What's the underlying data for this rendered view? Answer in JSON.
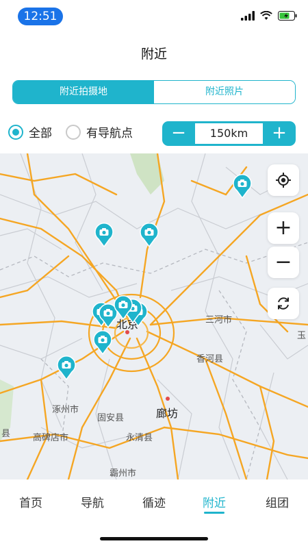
{
  "status_bar": {
    "time": "12:51"
  },
  "header": {
    "title": "附近"
  },
  "segment": {
    "tabs": [
      {
        "label": "附近拍摄地",
        "active": true
      },
      {
        "label": "附近照片",
        "active": false
      }
    ]
  },
  "filters": {
    "all_label": "全部",
    "guide_label": "有导航点",
    "selected": "all"
  },
  "distance": {
    "value": "150km",
    "minus": "−",
    "plus": "+"
  },
  "map": {
    "labels": {
      "beijing": "北京",
      "sanhe": "三河市",
      "xianghe": "香河县",
      "zhuozhou": "涿州市",
      "gu_an": "固安县",
      "langfang": "廊坊",
      "gaobeidian": "高碑店市",
      "yongqing": "永清县",
      "bazhou": "霸州市",
      "xian": "县",
      "yu": "玉"
    },
    "controls": {
      "zoom_in": "+",
      "zoom_out": "−"
    }
  },
  "tabbar": {
    "items": [
      {
        "label": "首页",
        "active": false
      },
      {
        "label": "导航",
        "active": false
      },
      {
        "label": "循迹",
        "active": false
      },
      {
        "label": "附近",
        "active": true
      },
      {
        "label": "组团",
        "active": false
      }
    ]
  },
  "colors": {
    "accent": "#1fb4cc",
    "road": "#f5a623",
    "map_bg": "#eceff3"
  }
}
